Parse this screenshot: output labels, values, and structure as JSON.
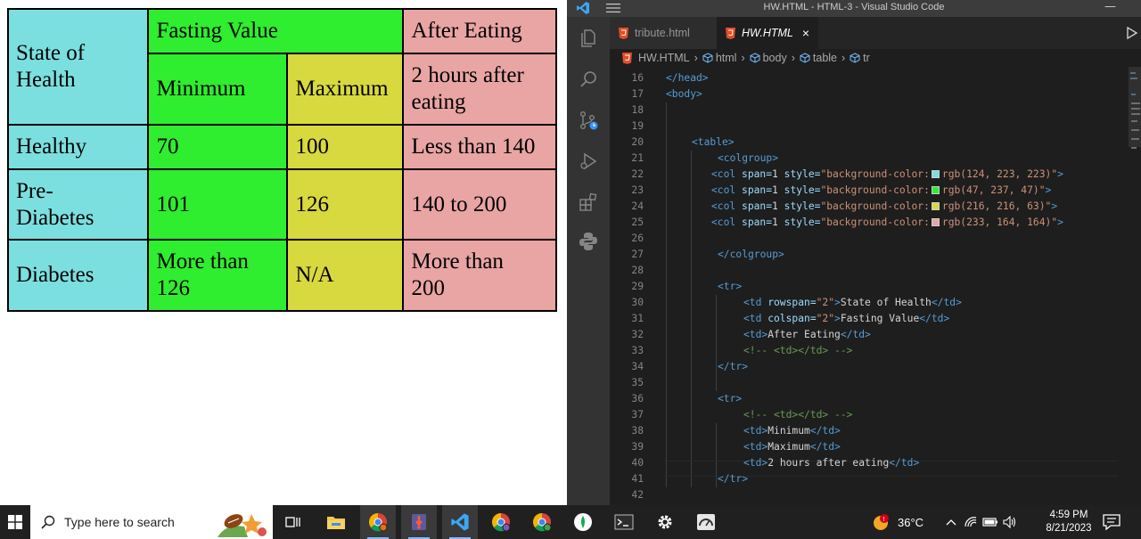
{
  "table": {
    "header_row1": {
      "state": "State of Health",
      "fasting": "Fasting Value",
      "after": "After Eating"
    },
    "header_row2": {
      "min": "Minimum",
      "max": "Maximum",
      "two_hours": "2 hours after eating"
    },
    "rows": [
      {
        "state": "Healthy",
        "min": "70",
        "max": "100",
        "after": "Less than 140"
      },
      {
        "state": "Pre-Diabetes",
        "min": "101",
        "max": "126",
        "after": "140 to 200"
      },
      {
        "state": "Diabetes",
        "min": "More than 126",
        "max": "N/A",
        "after": "More than 200"
      }
    ],
    "colors": {
      "col1": "#7cdfdf",
      "col2": "#2fed2f",
      "col3": "#d8d83f",
      "col4": "#e9a4a4"
    }
  },
  "vscode": {
    "title": "HW.HTML - HTML-3 - Visual Studio Code",
    "tabs": [
      {
        "label": "tribute.html"
      },
      {
        "label": "HW.HTML",
        "close": "×"
      }
    ],
    "breadcrumb": [
      "HW.HTML",
      "html",
      "body",
      "table",
      "tr"
    ],
    "activity_icons": [
      "explorer-icon",
      "search-icon",
      "source-control-icon",
      "run-debug-icon",
      "extensions-icon",
      "python-icon"
    ]
  },
  "code": {
    "line_numbers": [
      "16",
      "17",
      "18",
      "19",
      "20",
      "21",
      "22",
      "23",
      "24",
      "25",
      "26",
      "27",
      "28",
      "29",
      "30",
      "31",
      "32",
      "33",
      "34",
      "35",
      "36",
      "37",
      "38",
      "39",
      "40",
      "41",
      "42"
    ],
    "head_close": "</head>",
    "body_open": "<body>",
    "table_open": "<table>",
    "colgroup_open": "<colgroup>",
    "col_prefix": "<col ",
    "col_span_attr": "span=",
    "col_span_val": "1",
    "col_style_attr": " style=",
    "col_style_open": "\"background-color:",
    "col_values": [
      "rgb(124, 223, 223)\"",
      "rgb(47, 237, 47)\"",
      "rgb(216, 216, 63)\"",
      "rgb(233, 164, 164)\""
    ],
    "col_close": ">",
    "colgroup_close": "</colgroup>",
    "tr_open": "<tr>",
    "tr_close": "</tr>",
    "td_open": "<td",
    "td_close": "</td>",
    "td_gt": ">",
    "rowspan_attr": " rowspan=",
    "rowspan_val": "\"2\"",
    "colspan_attr": " colspan=",
    "colspan_val": "\"2\"",
    "text_state": "State of Health",
    "text_fasting": "Fasting Value",
    "text_after": "After Eating",
    "comment": "<!-- <td></td> -->",
    "text_min": "Minimum",
    "text_max": "Maximum",
    "text_2h": "2 hours after eating"
  },
  "taskbar": {
    "search_placeholder": "Type here to search",
    "weather_temp": "36°C",
    "time": "4:59 PM",
    "date": "8/21/2023"
  }
}
